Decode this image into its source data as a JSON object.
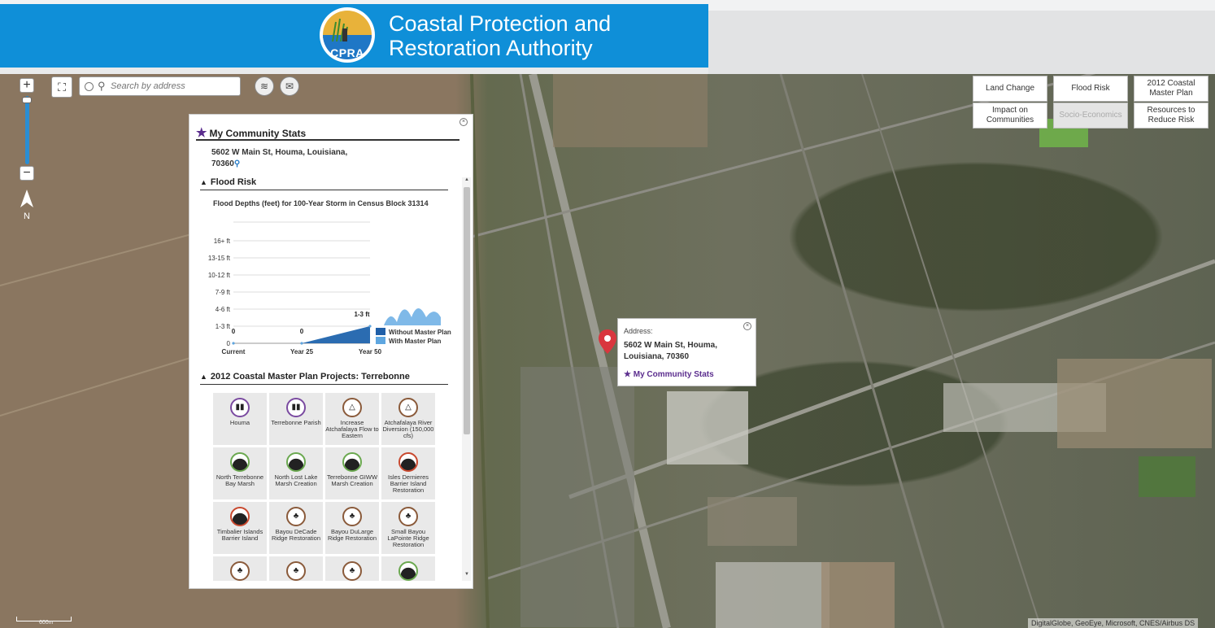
{
  "header": {
    "logo_text": "CPRA",
    "title_line1": "Coastal Protection and",
    "title_line2": "Restoration Authority"
  },
  "map": {
    "search_placeholder": "Search by address",
    "north_label": "N",
    "attribution": "DigitalGlobe, GeoEye, Microsoft, CNES/Airbus DS",
    "scale_label": "600m"
  },
  "topics": [
    {
      "label": "Land Change",
      "enabled": true
    },
    {
      "label": "Flood Risk",
      "enabled": true
    },
    {
      "label": "2012 Coastal Master Plan",
      "enabled": true
    },
    {
      "label": "Impact on Communities",
      "enabled": true
    },
    {
      "label": "Socio-Economics",
      "enabled": false
    },
    {
      "label": "Resources to Reduce Risk",
      "enabled": true
    }
  ],
  "panel": {
    "title": "My Community Stats",
    "address_line1": "5602 W Main St, Houma, Louisiana,",
    "address_line2": "70360",
    "flood_section": "Flood Risk",
    "chart_title": "Flood Depths (feet) for 100-Year Storm in Census Block 31314",
    "projects_section": "2012 Coastal Master Plan Projects: Terrebonne",
    "projects": [
      {
        "name": "Houma",
        "icon": "levee-icon",
        "color": "#7a4aa0"
      },
      {
        "name": "Terrebonne Parish",
        "icon": "levee-icon",
        "color": "#7a4aa0"
      },
      {
        "name": "Increase Atchafalaya Flow to Eastern",
        "icon": "diversion-icon",
        "color": "#8a5a3a"
      },
      {
        "name": "Atchafalaya River Diversion (150,000 cfs)",
        "icon": "diversion-icon",
        "color": "#8a5a3a"
      },
      {
        "name": "North Terrebonne Bay Marsh",
        "icon": "marsh-icon",
        "color": "#6aa84f"
      },
      {
        "name": "North Lost Lake Marsh Creation",
        "icon": "marsh-icon",
        "color": "#6aa84f"
      },
      {
        "name": "Terrebonne GIWW Marsh Creation",
        "icon": "marsh-icon",
        "color": "#6aa84f"
      },
      {
        "name": "Isles Dernieres Barrier Island Restoration",
        "icon": "barrier-island-icon",
        "color": "#c8482e"
      },
      {
        "name": "Timbalier Islands Barrier Island",
        "icon": "barrier-island-icon",
        "color": "#c8482e"
      },
      {
        "name": "Bayou DeCade Ridge Restoration",
        "icon": "ridge-icon",
        "color": "#8a5a3a"
      },
      {
        "name": "Bayou DuLarge Ridge Restoration",
        "icon": "ridge-icon",
        "color": "#8a5a3a"
      },
      {
        "name": "Small Bayou LaPointe Ridge Restoration",
        "icon": "ridge-icon",
        "color": "#8a5a3a"
      },
      {
        "name": "",
        "icon": "ridge-icon",
        "color": "#8a5a3a"
      },
      {
        "name": "",
        "icon": "ridge-icon",
        "color": "#8a5a3a"
      },
      {
        "name": "",
        "icon": "ridge-icon",
        "color": "#8a5a3a"
      },
      {
        "name": "",
        "icon": "marsh-icon",
        "color": "#6aa84f"
      }
    ]
  },
  "popup": {
    "label": "Address:",
    "address_line1": "5602 W Main St, Houma,",
    "address_line2": "Louisiana, 70360",
    "link": "My Community Stats"
  },
  "chart_data": {
    "type": "area",
    "title": "Flood Depths (feet) for 100-Year Storm in Census Block 31314",
    "categories": [
      "Current",
      "Year 25",
      "Year 50"
    ],
    "y_tick_labels": [
      "0",
      "1-3 ft",
      "4-6 ft",
      "7-9 ft",
      "10-12 ft",
      "13-15 ft",
      "16+ ft"
    ],
    "series": [
      {
        "name": "Without Master Plan",
        "values": [
          0,
          0,
          1
        ],
        "color": "#1f5fa8"
      },
      {
        "name": "With Master Plan",
        "values": [
          0,
          0,
          1
        ],
        "color": "#5ea6e0"
      }
    ],
    "data_labels": [
      "0",
      "0",
      "1-3 ft"
    ],
    "ylim": [
      0,
      7
    ],
    "legend": "bottom-right"
  }
}
